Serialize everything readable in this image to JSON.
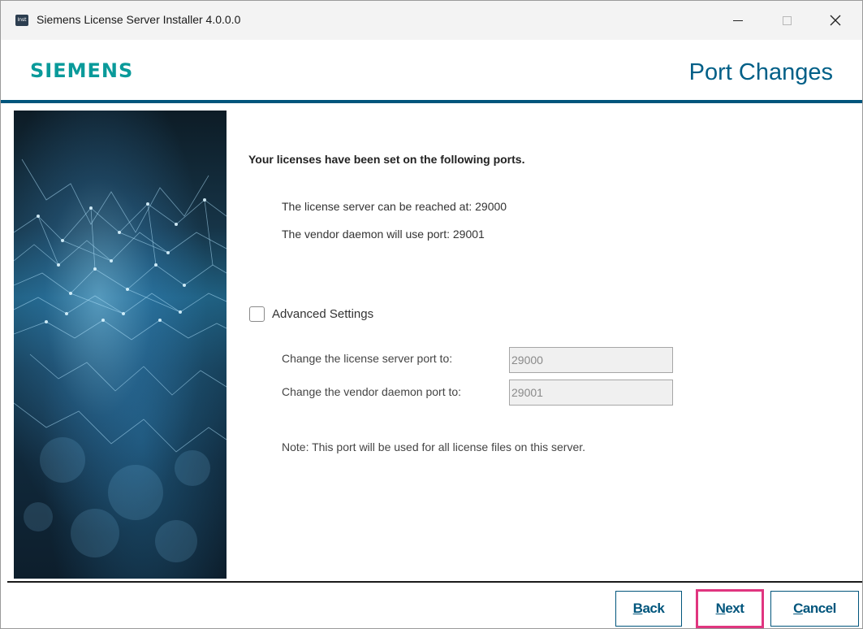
{
  "window": {
    "title": "Siemens License Server Installer 4.0.0.0",
    "app_icon_text": "Inst",
    "controls": {
      "minimize": "—",
      "maximize": "□",
      "close": "✕"
    }
  },
  "header": {
    "logo": "SIEMENS",
    "page_title": "Port Changes"
  },
  "content": {
    "intro": "Your licenses have been set on the following ports.",
    "license_server_line": "The license server can be reached at: 29000",
    "vendor_daemon_line": "The vendor daemon will use port: 29001",
    "advanced_settings": {
      "label": "Advanced Settings",
      "checked": false
    },
    "license_server_port": {
      "label": "Change the license server port to:",
      "value": "29000"
    },
    "vendor_daemon_port": {
      "label": "Change the vendor daemon port to:",
      "value": "29001"
    },
    "note": "Note: This port will be used for all license files on this server."
  },
  "buttons": {
    "back": {
      "first": "B",
      "rest": "ack"
    },
    "next": {
      "first": "N",
      "rest": "ext"
    },
    "cancel": {
      "first": "C",
      "rest": "ancel"
    }
  },
  "colors": {
    "brand_teal": "#0a9a9a",
    "accent_blue": "#00557c",
    "focus_highlight": "#e0357f"
  }
}
